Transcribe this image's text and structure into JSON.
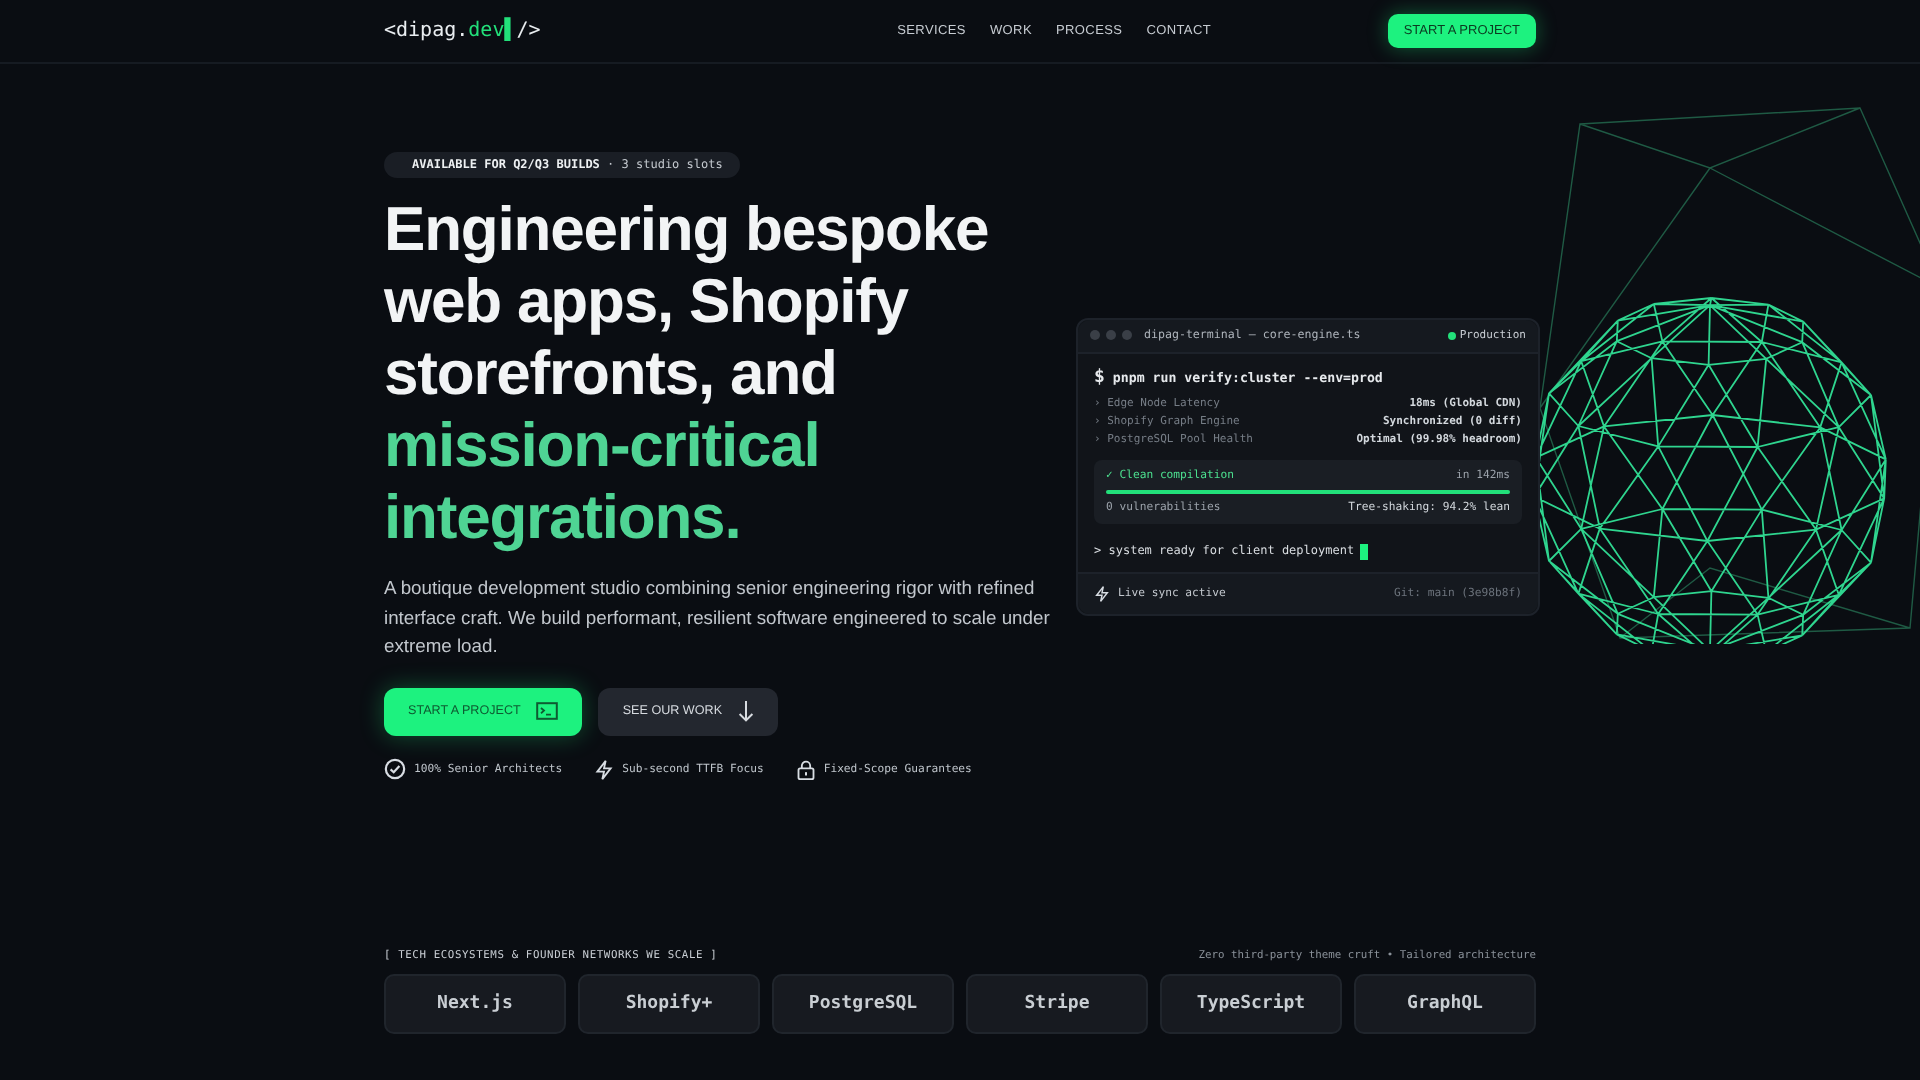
{
  "nav": {
    "logo_prefix": "<dipag.",
    "logo_accent": "dev",
    "logo_cursor": "▌",
    "logo_suffix": "/>",
    "links": [
      "SERVICES",
      "WORK",
      "PROCESS",
      "CONTACT"
    ],
    "cta": "START A PROJECT"
  },
  "hero": {
    "badge_strong": "AVAILABLE FOR Q2/Q3 BUILDS",
    "badge_rest": "· 3 studio slots",
    "headline": "Engineering bespoke web apps, Shopify storefronts, and",
    "headline_accent": "mission-critical integrations.",
    "lead": "A boutique development studio combining senior engineering rigor with refined interface craft. We build performant, resilient software engineered to scale under extreme load.",
    "buttons": [
      {
        "label": "START A PROJECT",
        "kind": "primary"
      },
      {
        "label": "SEE OUR WORK",
        "kind": "secondary"
      }
    ],
    "features": [
      {
        "label": "100% Senior Architects",
        "kind": "badge"
      },
      {
        "label": "Sub-second TTFB Focus",
        "kind": "bolt"
      },
      {
        "label": "Fixed-Scope Guarantees",
        "kind": "lock"
      }
    ]
  },
  "terminal": {
    "title": "dipag-terminal — core-engine.ts",
    "env": "Production",
    "env_live": true,
    "prompt": "$",
    "bullet": "›",
    "output_prompt": ">",
    "command": "pnpm run verify:cluster --env=prod",
    "checks": [
      {
        "label": "Edge Node Latency",
        "value": "18ms (Global CDN)"
      },
      {
        "label": "Shopify Graph Engine",
        "value": "Synchronized (0 diff)"
      },
      {
        "label": "PostgreSQL Pool Health",
        "value": "Optimal (99.98% headroom)"
      }
    ],
    "build": {
      "status": "✓ Clean compilation",
      "time": "in 142ms",
      "level": 1,
      "vulns": "0 vulnerabilities",
      "tree": "Tree-shaking: 94.2% lean"
    },
    "output": "system ready for client deployment",
    "footer_status": "Live sync active",
    "git": "Git: main (3e98b8f)"
  },
  "tech": {
    "heading": "[ TECH ECOSYSTEMS & FOUNDER NETWORKS WE SCALE ]",
    "note": "Zero third-party theme cruft • Tailored architecture",
    "items": [
      "Next.js",
      "Shopify+",
      "PostgreSQL",
      "Stripe",
      "TypeScript",
      "GraphQL"
    ]
  }
}
